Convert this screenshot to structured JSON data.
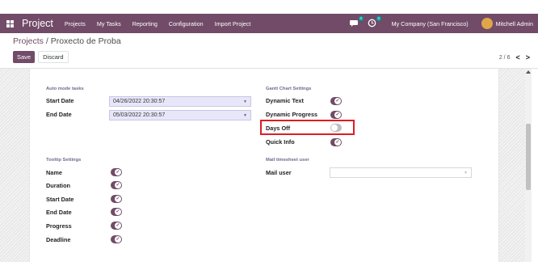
{
  "topbar": {
    "app_title": "Project",
    "menu": [
      "Projects",
      "My Tasks",
      "Reporting",
      "Configuration",
      "Import Project"
    ],
    "messages_badge": "3",
    "activity_badge": "3",
    "company": "My Company (San Francisco)",
    "user": "Mitchell Admin",
    "icons": [
      "apps-grid-icon",
      "chat-icon",
      "clock-icon",
      "avatar"
    ],
    "color": "#714B67"
  },
  "breadcrumb": {
    "parent": "Projects",
    "separator": " / ",
    "current": "Proxecto de Proba"
  },
  "actions": {
    "save": "Save",
    "discard": "Discard"
  },
  "pager": {
    "value": "2 / 6",
    "prev": "<",
    "next": ">"
  },
  "form": {
    "auto_mode": {
      "title": "Auto mode tasks",
      "start_label": "Start Date",
      "start_value": "04/26/2022 20:30:57",
      "end_label": "End Date",
      "end_value": "05/03/2022 20:30:57"
    },
    "gantt": {
      "title": "Gantt Chart Settings",
      "dynamic_text": "Dynamic Text",
      "dynamic_progress": "Dynamic Progress",
      "days_off": "Days Off",
      "quick_info": "Quick Info",
      "toggles": {
        "dynamic_text": true,
        "dynamic_progress": true,
        "days_off": false,
        "quick_info": true
      }
    },
    "tooltip": {
      "title": "Tooltip Settings",
      "name": "Name",
      "duration": "Duration",
      "start_date": "Start Date",
      "end_date": "End Date",
      "progress": "Progress",
      "deadline": "Deadline",
      "toggles": {
        "name": true,
        "duration": true,
        "start_date": true,
        "end_date": true,
        "progress": true,
        "deadline": true
      }
    },
    "mail": {
      "title": "Mail timesheet user",
      "label": "Mail user",
      "value": ""
    }
  },
  "highlight_color": "#e01b24"
}
